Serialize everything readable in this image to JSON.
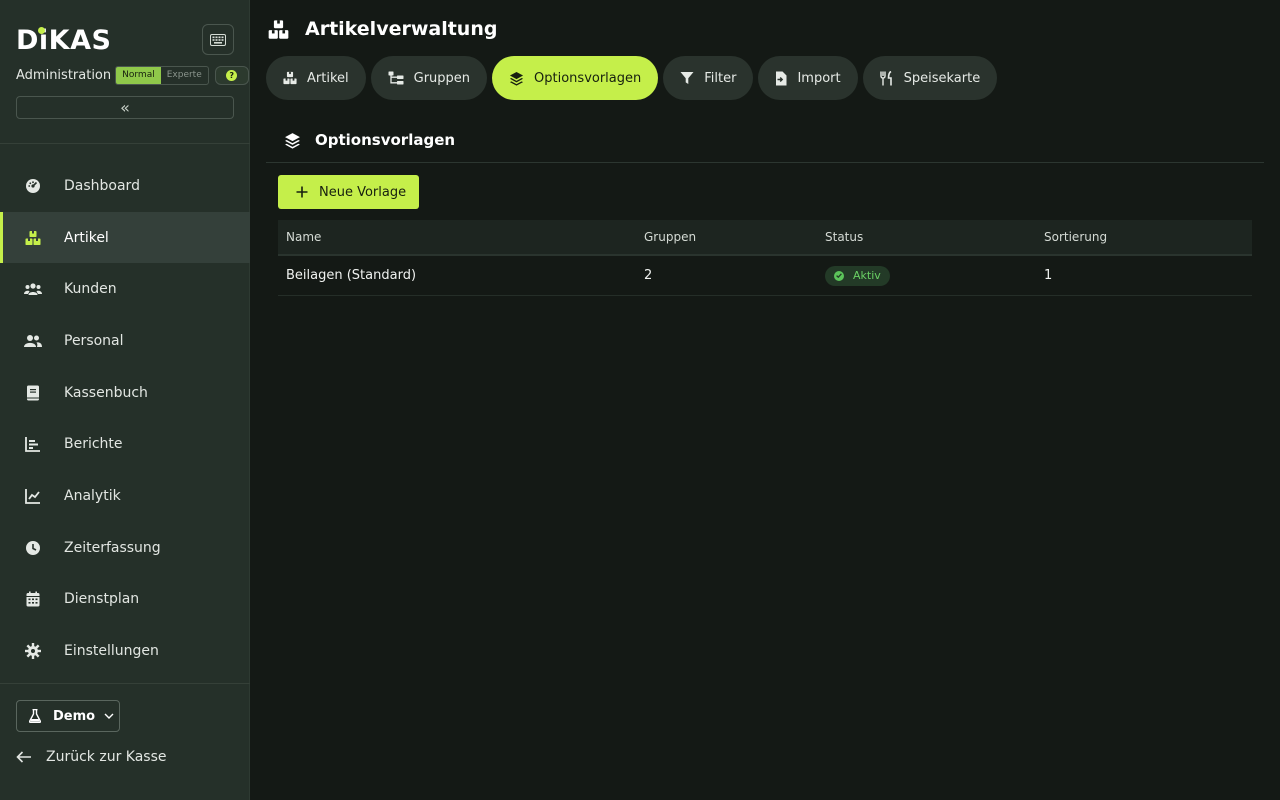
{
  "sidebar": {
    "brand": "DiKAS",
    "role": "Administration",
    "modes": [
      "Normal",
      "Experte"
    ],
    "active_mode": "Normal",
    "help_symbol": "?",
    "collapse_symbol": "«",
    "nav": [
      {
        "label": "Dashboard",
        "icon": "dashboard-icon"
      },
      {
        "label": "Artikel",
        "icon": "boxes-icon",
        "active": true
      },
      {
        "label": "Kunden",
        "icon": "users-icon"
      },
      {
        "label": "Personal",
        "icon": "user-group-icon"
      },
      {
        "label": "Kassenbuch",
        "icon": "book-icon"
      },
      {
        "label": "Berichte",
        "icon": "bar-chart-icon"
      },
      {
        "label": "Analytik",
        "icon": "line-chart-icon"
      },
      {
        "label": "Zeiterfassung",
        "icon": "clock-icon"
      },
      {
        "label": "Dienstplan",
        "icon": "calendar-icon"
      },
      {
        "label": "Einstellungen",
        "icon": "gear-icon"
      }
    ],
    "environment": "Demo",
    "back_label": "Zurück zur Kasse"
  },
  "header": {
    "title": "Artikelverwaltung",
    "tabs": [
      {
        "label": "Artikel",
        "icon": "boxes-icon"
      },
      {
        "label": "Gruppen",
        "icon": "tree-icon"
      },
      {
        "label": "Optionsvorlagen",
        "icon": "layers-icon",
        "active": true
      },
      {
        "label": "Filter",
        "icon": "filter-icon"
      },
      {
        "label": "Import",
        "icon": "file-import-icon"
      },
      {
        "label": "Speisekarte",
        "icon": "utensils-icon"
      }
    ]
  },
  "section": {
    "title": "Optionsvorlagen",
    "new_button": "Neue Vorlage"
  },
  "table": {
    "columns": [
      "Name",
      "Gruppen",
      "Status",
      "Sortierung"
    ],
    "rows": [
      {
        "name": "Beilagen (Standard)",
        "groups": "2",
        "status": "Aktiv",
        "sort": "1"
      }
    ]
  },
  "colors": {
    "accent": "#c5ef4a",
    "sidebar_bg": "#253029",
    "main_bg": "#141915",
    "status_active": "#5cc45a"
  }
}
